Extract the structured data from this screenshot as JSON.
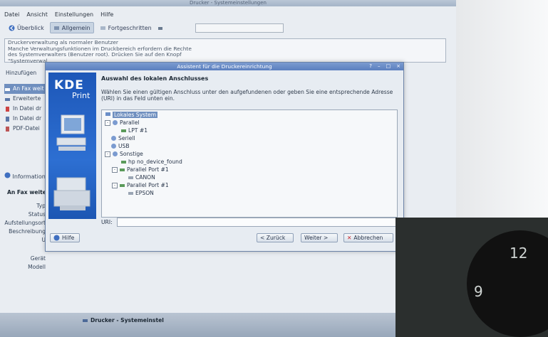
{
  "main_window": {
    "title": "Drucker - Systemeinstellungen",
    "menu": [
      "Datei",
      "Ansicht",
      "Einstellungen",
      "Hilfe"
    ],
    "toolbar": [
      "Überblick",
      "Allgemein",
      "Fortgeschritten"
    ],
    "info_lines": [
      "Druckerverwaltung als normaler Benutzer",
      "Manche Verwaltungsfunktionen im Druckbereich erfordern die Rechte",
      "des Systemverwalters (Benutzer root). Drücken Sie auf den Knopf",
      "\"Systemverwal"
    ],
    "add_button": "Hinzufügen",
    "printer_list": [
      "An Fax weit",
      "Erweiterte",
      "In Datei dr",
      "In Datei dr",
      "PDF-Datei"
    ],
    "info_tab": "Information",
    "section_title": "An Fax weite",
    "property_labels": [
      "Typ",
      "Status",
      "Aufstellungsort",
      "Beschreibung",
      "U",
      "Gerät",
      "Modell"
    ]
  },
  "dialog": {
    "title": "Assistent für die Druckereinrichtung",
    "banner_logo": "KDE",
    "banner_sub": "Print",
    "heading": "Auswahl des lokalen Anschlusses",
    "description": "Wählen Sie einen gültigen Anschluss unter den aufgefundenen oder geben Sie eine entsprechende Adresse (URI) in das Feld unten ein.",
    "tree": [
      {
        "label": "Lokales System",
        "level": 0,
        "selected": true
      },
      {
        "label": "Parallel",
        "level": 1,
        "expander": "-"
      },
      {
        "label": "LPT #1",
        "level": 2
      },
      {
        "label": "Seriell",
        "level": 1
      },
      {
        "label": "USB",
        "level": 1
      },
      {
        "label": "Sonstige",
        "level": 1,
        "expander": "-"
      },
      {
        "label": "hp no_device_found",
        "level": 2
      },
      {
        "label": "Parallel Port #1",
        "level": 2,
        "expander": "-"
      },
      {
        "label": "CANON",
        "level": 3
      },
      {
        "label": "Parallel Port #1",
        "level": 2,
        "expander": "-"
      },
      {
        "label": "EPSON",
        "level": 3
      }
    ],
    "uri_label": "URI:",
    "uri_value": "",
    "buttons": {
      "help": "Hilfe",
      "back": "< Zurück",
      "next": "Weiter >",
      "cancel": "Abbrechen"
    }
  },
  "taskbar": {
    "task_title": "Drucker - Systemeinstel"
  },
  "clock_numbers": [
    "12",
    "9"
  ],
  "colors": {
    "accent": "#5b7fbf",
    "banner": "#2d6fd2",
    "selection": "#6f8fbf"
  }
}
